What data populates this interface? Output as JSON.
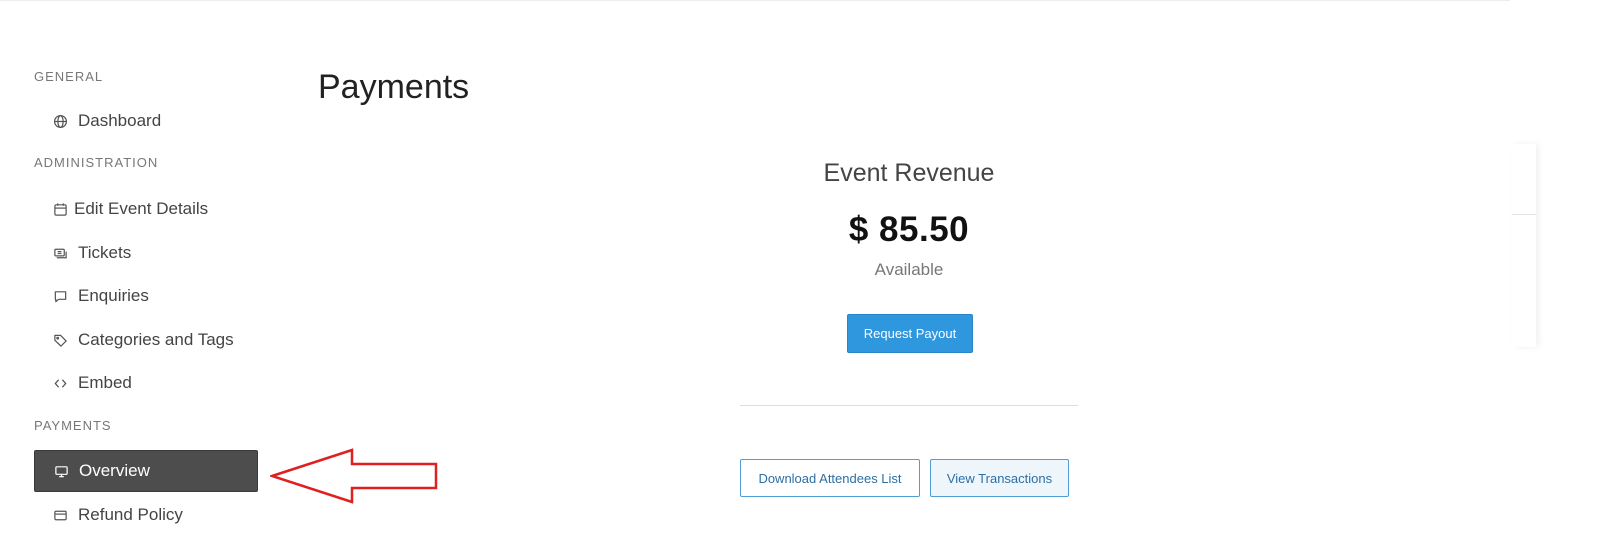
{
  "sidebar": {
    "sections": {
      "general": "GENERAL",
      "administration": "ADMINISTRATION",
      "payments": "PAYMENTS"
    },
    "items": {
      "dashboard": {
        "label": "Dashboard",
        "icon": "globe-icon"
      },
      "edit_event": {
        "label": "Edit Event Details",
        "icon": "calendar-icon"
      },
      "tickets": {
        "label": "Tickets",
        "icon": "ticket-icon"
      },
      "enquiries": {
        "label": "Enquiries",
        "icon": "chat-icon"
      },
      "categories": {
        "label": "Categories and Tags",
        "icon": "tag-icon"
      },
      "embed": {
        "label": "Embed",
        "icon": "code-icon"
      },
      "overview": {
        "label": "Overview",
        "icon": "monitor-icon",
        "active": true
      },
      "refund": {
        "label": "Refund Policy",
        "icon": "card-icon"
      }
    }
  },
  "main": {
    "title": "Payments",
    "revenue": {
      "title": "Event Revenue",
      "amount": "$ 85.50",
      "status": "Available"
    },
    "buttons": {
      "request_payout": "Request Payout",
      "download_attendees": "Download Attendees List",
      "view_transactions": "View Transactions"
    }
  },
  "colors": {
    "primary": "#2f97dd",
    "active_nav": "#4d4d4d",
    "annotation_arrow": "#e02020"
  }
}
